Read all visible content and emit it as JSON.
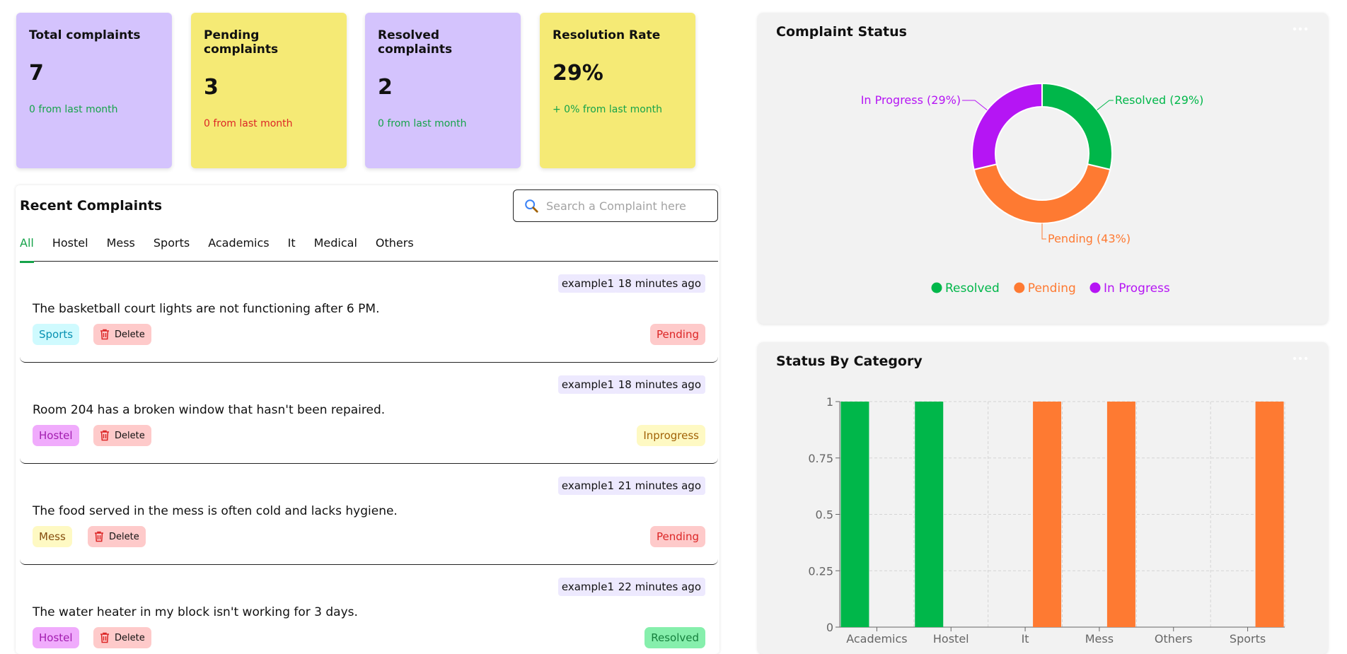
{
  "stats": [
    {
      "title": "Total complaints",
      "value": "7",
      "delta": "0 from last month",
      "delta_color": "#16a34a",
      "bg": "purple"
    },
    {
      "title": "Pending complaints",
      "value": "3",
      "delta": "0 from last month",
      "delta_color": "#dc2626",
      "bg": "yellow"
    },
    {
      "title": "Resolved complaints",
      "value": "2",
      "delta": "0 from last month",
      "delta_color": "#16a34a",
      "bg": "purple"
    },
    {
      "title": "Resolution Rate",
      "value": "29%",
      "delta": "+ 0% from last month",
      "delta_color": "#16a34a",
      "bg": "yellow"
    }
  ],
  "recent": {
    "title": "Recent Complaints",
    "search_placeholder": "Search a Complaint here",
    "tabs": [
      "All",
      "Hostel",
      "Mess",
      "Sports",
      "Academics",
      "It",
      "Medical",
      "Others"
    ],
    "active_tab": "All",
    "delete_label": "Delete",
    "items": [
      {
        "user": "example1",
        "time": "18 minutes ago",
        "description": "The basketball court lights are not functioning after 6 PM.",
        "category": "Sports",
        "status": "Pending"
      },
      {
        "user": "example1",
        "time": "18 minutes ago",
        "description": "Room 204 has a broken window that hasn't been repaired.",
        "category": "Hostel",
        "status": "Inprogress"
      },
      {
        "user": "example1",
        "time": "21 minutes ago",
        "description": "The food served in the mess is often cold and lacks hygiene.",
        "category": "Mess",
        "status": "Pending"
      },
      {
        "user": "example1",
        "time": "22 minutes ago",
        "description": "The water heater in my block isn't working for 3 days.",
        "category": "Hostel",
        "status": "Resolved"
      }
    ]
  },
  "colors": {
    "resolved": "#00b74a",
    "pending": "#fe7a32",
    "in_progress": "#b515f4"
  },
  "chart_data": [
    {
      "type": "pie",
      "title": "Complaint Status",
      "labels": [
        "Resolved",
        "Pending",
        "In Progress"
      ],
      "values": [
        29,
        43,
        29
      ],
      "slice_labels": [
        "Resolved (29%)",
        "Pending (43%)",
        "In Progress (29%)"
      ],
      "donut": true,
      "legend_position": "bottom"
    },
    {
      "type": "bar",
      "title": "Status By Category",
      "categories": [
        "Academics",
        "Hostel",
        "It",
        "Mess",
        "Others",
        "Sports"
      ],
      "series": [
        {
          "name": "Resolved",
          "values": [
            1,
            1,
            0,
            0,
            0,
            0
          ]
        },
        {
          "name": "Pending",
          "values": [
            0,
            0,
            1,
            1,
            0,
            1
          ]
        }
      ],
      "yticks": [
        "0",
        "0.25",
        "0.5",
        "0.75",
        "1"
      ],
      "ylim": [
        0,
        1
      ],
      "grid": true
    }
  ]
}
